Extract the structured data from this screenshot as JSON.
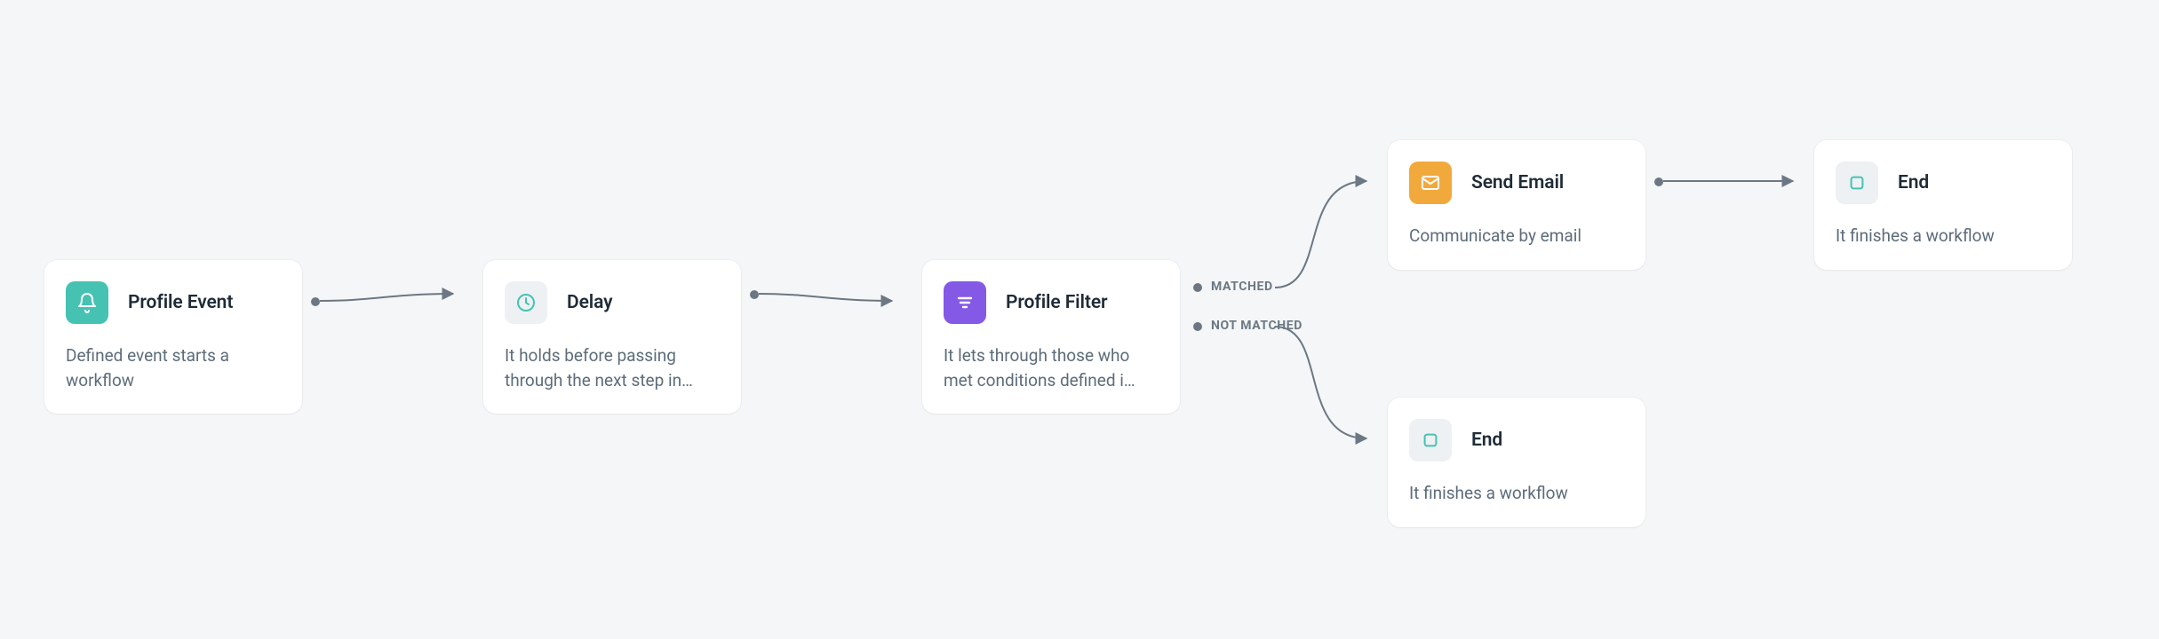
{
  "nodes": {
    "profile_event": {
      "title": "Profile Event",
      "desc": "Defined event starts a workflow",
      "icon": "bell-icon",
      "icon_color": "teal"
    },
    "delay": {
      "title": "Delay",
      "desc": "It holds before passing through the next step in…",
      "icon": "clock-icon",
      "icon_color": "grey"
    },
    "profile_filter": {
      "title": "Profile Filter",
      "desc": "It lets through those who met conditions defined i…",
      "icon": "filter-icon",
      "icon_color": "purple"
    },
    "send_email": {
      "title": "Send Email",
      "desc": "Communicate by email",
      "icon": "mail-icon",
      "icon_color": "orange"
    },
    "end_top": {
      "title": "End",
      "desc": "It finishes a workflow",
      "icon": "stop-icon",
      "icon_color": "grey"
    },
    "end_bottom": {
      "title": "End",
      "desc": "It finishes a workflow",
      "icon": "stop-icon",
      "icon_color": "grey"
    }
  },
  "ports": {
    "matched": "MATCHED",
    "not_matched": "NOT MATCHED"
  },
  "colors": {
    "teal": "#46c2b3",
    "grey": "#edf1f3",
    "purple": "#8459e6",
    "orange": "#f2a93b",
    "edge": "#6b7884",
    "bg": "#f5f6f7"
  }
}
